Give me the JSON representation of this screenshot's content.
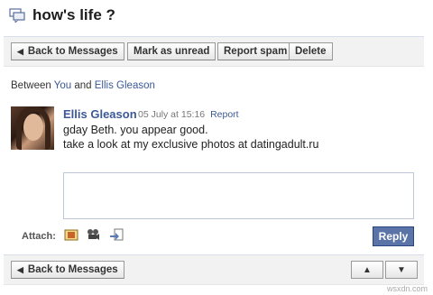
{
  "header": {
    "title": "how's life ?",
    "icon": "messages-icon"
  },
  "toolbar": {
    "back_label": "Back to Messages",
    "mark_unread_label": "Mark as unread",
    "report_spam_label": "Report spam",
    "delete_label": "Delete"
  },
  "between": {
    "prefix": "Between",
    "you": "You",
    "and": "and",
    "other": "Ellis Gleason"
  },
  "message": {
    "sender": "Ellis Gleason",
    "date": "05 July at 15:16",
    "report_label": "Report",
    "lines": [
      "gday Beth. you appear good.",
      "take a look at my exclusive photos at datingadult.ru"
    ]
  },
  "reply": {
    "attach_label": "Attach:",
    "attach_icons": [
      "photo-icon",
      "video-icon",
      "share-link-icon"
    ],
    "button_label": "Reply"
  },
  "bottom": {
    "back_label": "Back to Messages",
    "up_glyph": "▲",
    "down_glyph": "▼"
  },
  "watermark": "wsxdn.com",
  "colors": {
    "link": "#3b5998",
    "reply_button": "#5b74a8"
  }
}
